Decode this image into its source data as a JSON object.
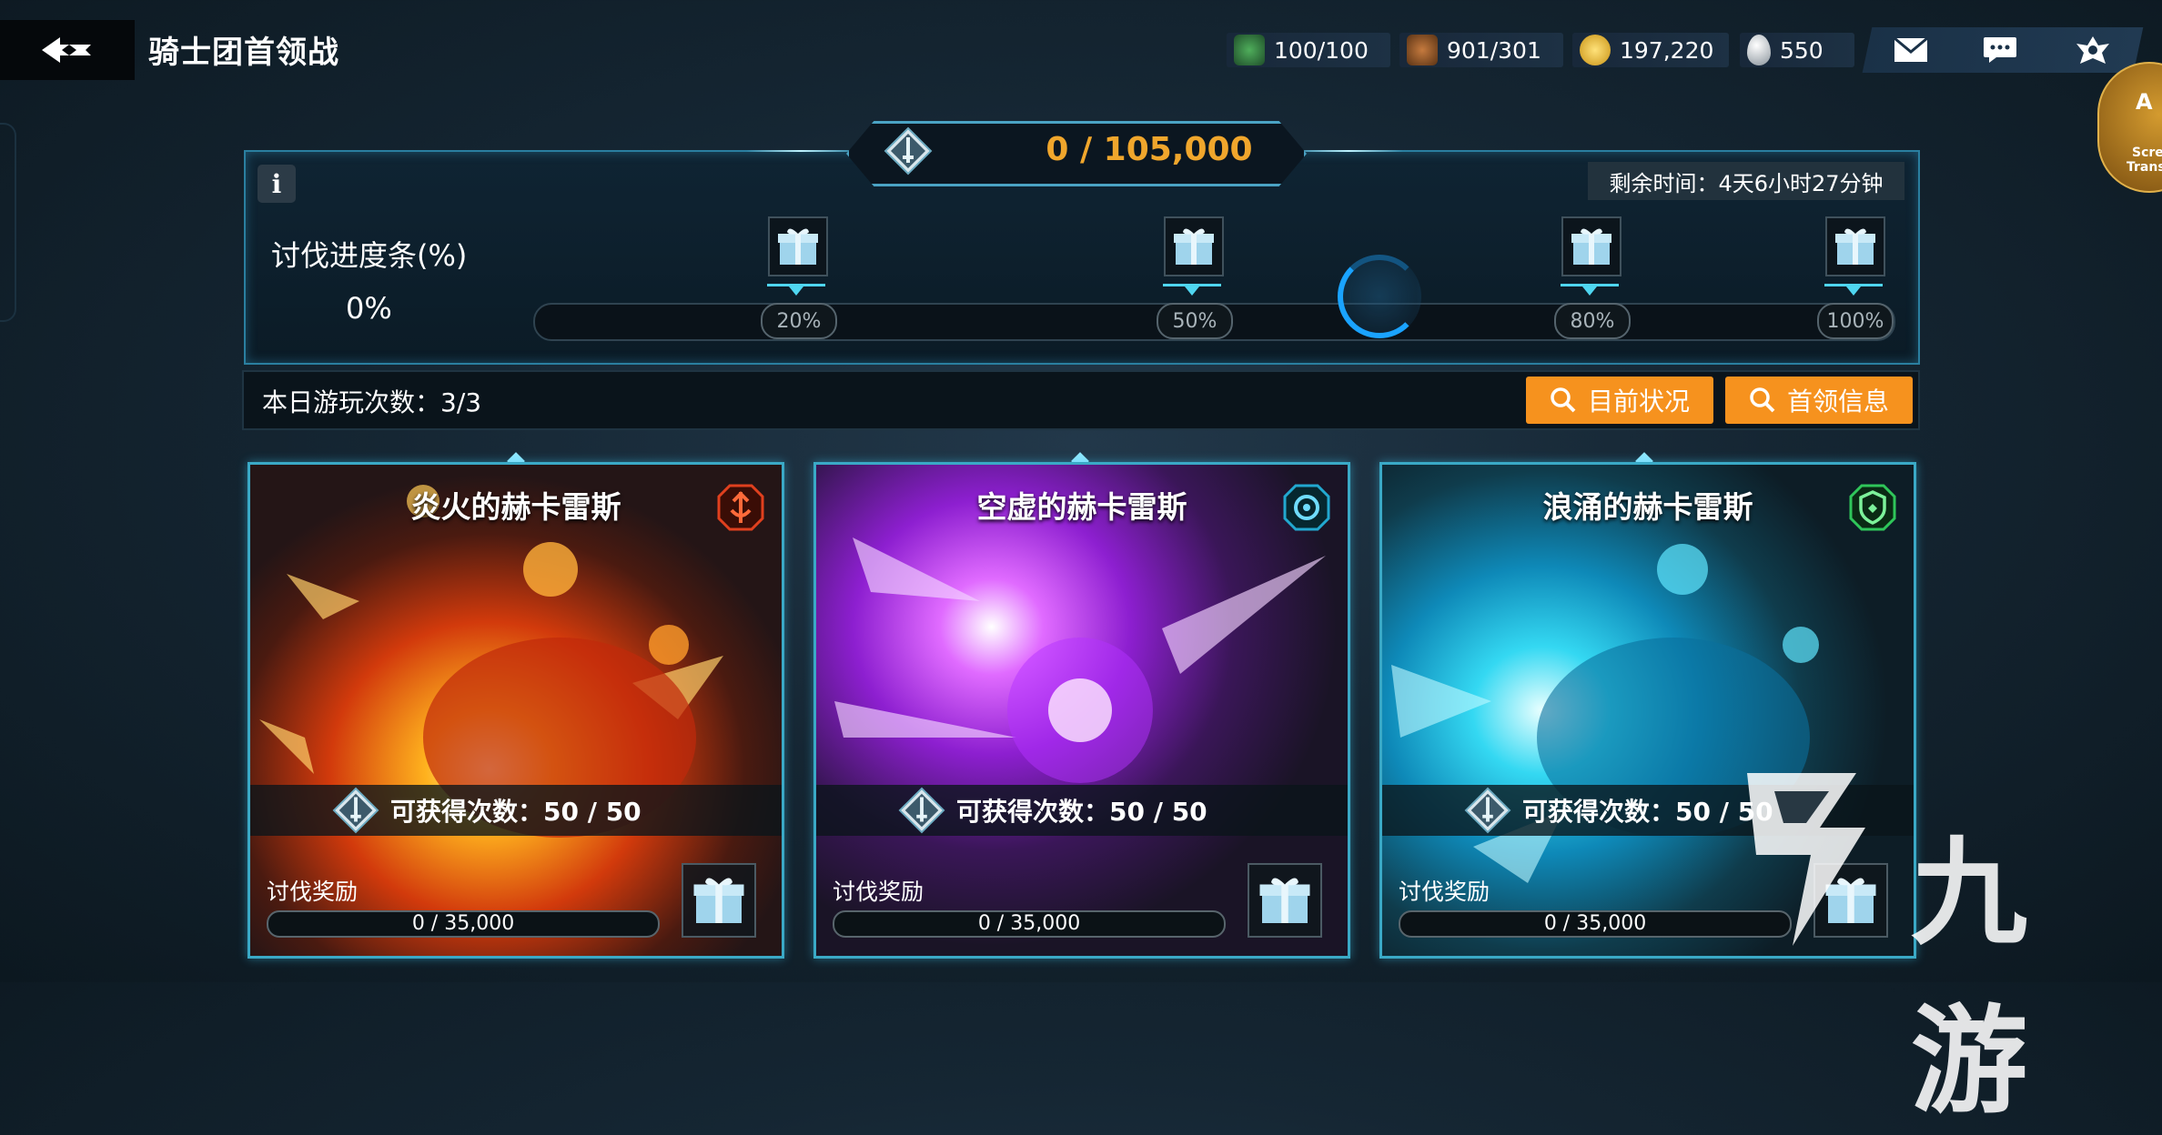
{
  "header": {
    "title": "骑士团首领战"
  },
  "resources": [
    {
      "icon": "stamina-icon",
      "value": "100/100"
    },
    {
      "icon": "boot-icon",
      "value": "901/301"
    },
    {
      "icon": "gold-coin-icon",
      "value": "197,220"
    },
    {
      "icon": "crystal-drop-icon",
      "value": "550"
    }
  ],
  "translate_badge": {
    "letter": "A",
    "line1": "Scre",
    "line2": "Trans"
  },
  "progress": {
    "total": "0 / 105,000",
    "remaining": "剩余时间：4天6小时27分钟",
    "label": "讨伐进度条(%)",
    "percent": "0%",
    "percent_value": 0,
    "milestones": [
      "20%",
      "50%",
      "80%",
      "100%"
    ]
  },
  "play": {
    "count": "本日游玩次数：3/3",
    "btn_status": "目前状况",
    "btn_info": "首领信息"
  },
  "bosses": [
    {
      "name": "炎火的赫卡雷斯",
      "element": "fire",
      "element_color": "#e0401e",
      "attempts": "可获得次数：50 / 50",
      "reward_label": "讨伐奖励",
      "reward": "0 / 35,000"
    },
    {
      "name": "空虚的赫卡雷斯",
      "element": "void",
      "element_color": "#22a8d0",
      "attempts": "可获得次数：50 / 50",
      "reward_label": "讨伐奖励",
      "reward": "0 / 35,000"
    },
    {
      "name": "浪涌的赫卡雷斯",
      "element": "wave",
      "element_color": "#2fc65a",
      "attempts": "可获得次数：50 / 50",
      "reward_label": "讨伐奖励",
      "reward": "0 / 35,000"
    }
  ],
  "colors": {
    "accent": "#f6921e",
    "progress_text": "#f0a62c",
    "frame": "#3aa9c6"
  },
  "watermark": {
    "text": "九游"
  }
}
